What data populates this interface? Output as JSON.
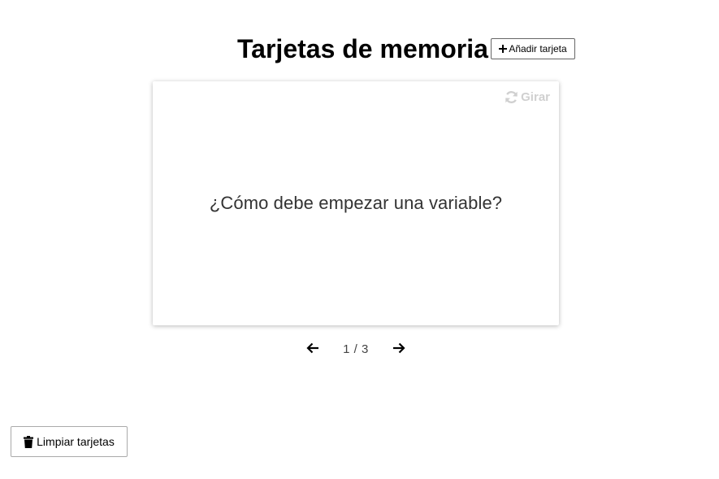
{
  "header": {
    "title": "Tarjetas de memoria",
    "add_button_label": "Añadir tarjeta",
    "add_icon": "plus-icon"
  },
  "card": {
    "flip_label": "Girar",
    "flip_icon": "sync-icon",
    "question": "¿Cómo debe empezar una variable?"
  },
  "navigation": {
    "prev_icon": "arrow-left-icon",
    "next_icon": "arrow-right-icon",
    "current": 1,
    "total": 3,
    "counter_text": "1 / 3"
  },
  "footer": {
    "clear_button_label": "Limpiar tarjetas",
    "clear_icon": "trash-icon"
  },
  "colors": {
    "background": "#ffffff",
    "flip_text": "#d0d0d0",
    "card_text": "#333333"
  }
}
